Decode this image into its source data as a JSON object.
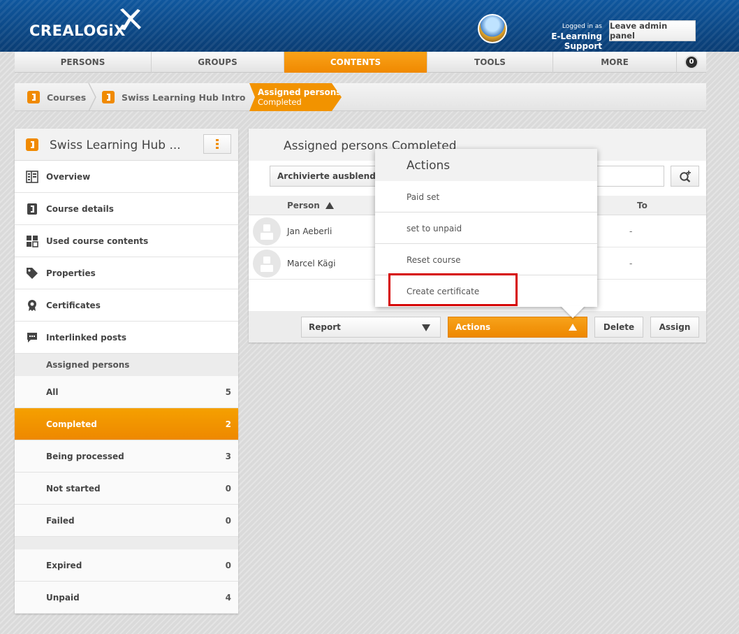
{
  "header": {
    "logo_text": "CREALOGiX",
    "logged_in_label": "Logged in as",
    "user_name": "E-Learning Support",
    "leave_admin_label": "Leave admin panel",
    "brand_color": "#0d4a8a",
    "accent_color": "#f29300"
  },
  "nav": {
    "items": [
      {
        "label": "PERSONS"
      },
      {
        "label": "GROUPS"
      },
      {
        "label": "CONTENTS"
      },
      {
        "label": "TOOLS"
      },
      {
        "label": "MORE"
      }
    ],
    "badge": "0"
  },
  "breadcrumb": {
    "items": [
      {
        "label": "Courses",
        "icon": "course-icon"
      },
      {
        "label": "Swiss Learning Hub Intro",
        "icon": "course-icon"
      }
    ],
    "active_title": "Assigned persons",
    "active_subtitle": "Completed"
  },
  "sidebar": {
    "title": "Swiss Learning Hub ...",
    "items": [
      {
        "label": "Overview",
        "icon": "overview-grid-icon"
      },
      {
        "label": "Course details",
        "icon": "course-details-icon"
      },
      {
        "label": "Used course contents",
        "icon": "course-contents-icon"
      },
      {
        "label": "Properties",
        "icon": "tag-icon"
      },
      {
        "label": "Certificates",
        "icon": "certificate-seal-icon"
      },
      {
        "label": "Interlinked posts",
        "icon": "chat-icon"
      }
    ],
    "section_label": "Assigned persons",
    "stats": [
      {
        "label": "All",
        "count": "5"
      },
      {
        "label": "Completed",
        "count": "2"
      },
      {
        "label": "Being processed",
        "count": "3"
      },
      {
        "label": "Not started",
        "count": "0"
      },
      {
        "label": "Failed",
        "count": "0"
      }
    ],
    "extra_stats": [
      {
        "label": "Expired",
        "count": "0"
      },
      {
        "label": "Unpaid",
        "count": "4"
      }
    ]
  },
  "main": {
    "title": "Assigned persons Completed",
    "archive_button": "Archivierte ausblenden",
    "search_value": "",
    "columns": {
      "person": "Person",
      "to": "To"
    },
    "rows": [
      {
        "name": "Jan Aeberli",
        "to": "-"
      },
      {
        "name": "Marcel Kägi",
        "to": "-"
      }
    ],
    "footer": {
      "report_label": "Report",
      "actions_label": "Actions",
      "delete_label": "Delete",
      "assign_label": "Assign"
    }
  },
  "actions_menu": {
    "title": "Actions",
    "items": [
      {
        "label": "Paid set"
      },
      {
        "label": "set to unpaid"
      },
      {
        "label": "Reset course"
      },
      {
        "label": "Create certificate"
      }
    ],
    "highlight_color": "#d60000"
  }
}
